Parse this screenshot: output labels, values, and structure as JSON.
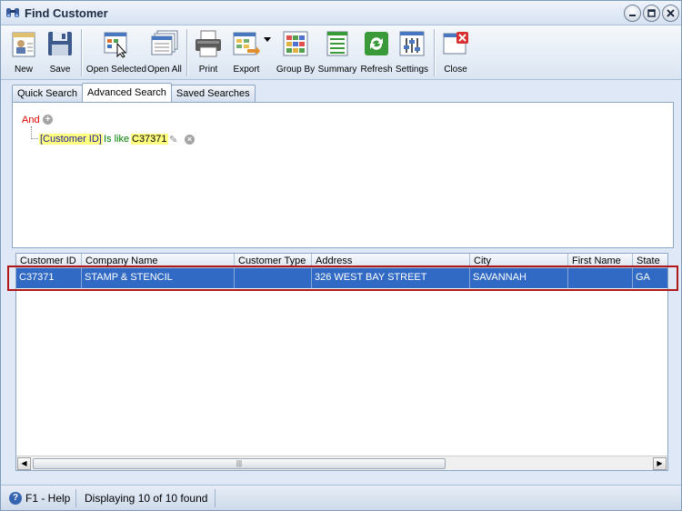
{
  "window": {
    "title": "Find Customer",
    "controls": [
      "minimize",
      "maximize",
      "close"
    ]
  },
  "toolbar": {
    "buttons": [
      {
        "id": "new",
        "label": "New",
        "icon": "new-document-icon"
      },
      {
        "id": "save",
        "label": "Save",
        "icon": "floppy-disk-icon"
      },
      {
        "id": "open-selected",
        "label": "Open Selected",
        "icon": "open-selected-icon"
      },
      {
        "id": "open-all",
        "label": "Open All",
        "icon": "open-all-icon"
      },
      {
        "id": "print",
        "label": "Print",
        "icon": "printer-icon"
      },
      {
        "id": "export",
        "label": "Export",
        "icon": "export-icon"
      },
      {
        "id": "group-by",
        "label": "Group By",
        "icon": "group-by-icon"
      },
      {
        "id": "summary",
        "label": "Summary",
        "icon": "summary-icon"
      },
      {
        "id": "refresh",
        "label": "Refresh",
        "icon": "refresh-icon"
      },
      {
        "id": "settings",
        "label": "Settings",
        "icon": "settings-icon"
      },
      {
        "id": "close",
        "label": "Close",
        "icon": "close-window-icon"
      }
    ]
  },
  "tabs": [
    {
      "label": "Quick Search",
      "active": false
    },
    {
      "label": "Advanced Search",
      "active": true
    },
    {
      "label": "Saved Searches",
      "active": false
    }
  ],
  "filter": {
    "group_operator": "And",
    "condition": {
      "field": "[Customer ID]",
      "operator": "Is like",
      "value": "C37371"
    }
  },
  "grid": {
    "columns": [
      "Customer ID",
      "Company Name",
      "Customer Type",
      "Address",
      "City",
      "First Name",
      "State"
    ],
    "rows": [
      [
        "C37371",
        "STAMP & STENCIL",
        "",
        "326 WEST BAY STREET",
        "SAVANNAH",
        "",
        "GA"
      ]
    ],
    "selected_row": 0
  },
  "statusbar": {
    "help": "F1 - Help",
    "message": "Displaying 10 of 10 found"
  },
  "colors": {
    "selection": "#316ac5",
    "highlight_border": "#b01818",
    "filter_and": "#e00000",
    "filter_field_bg": "#ffff80",
    "filter_operator": "#008000"
  }
}
